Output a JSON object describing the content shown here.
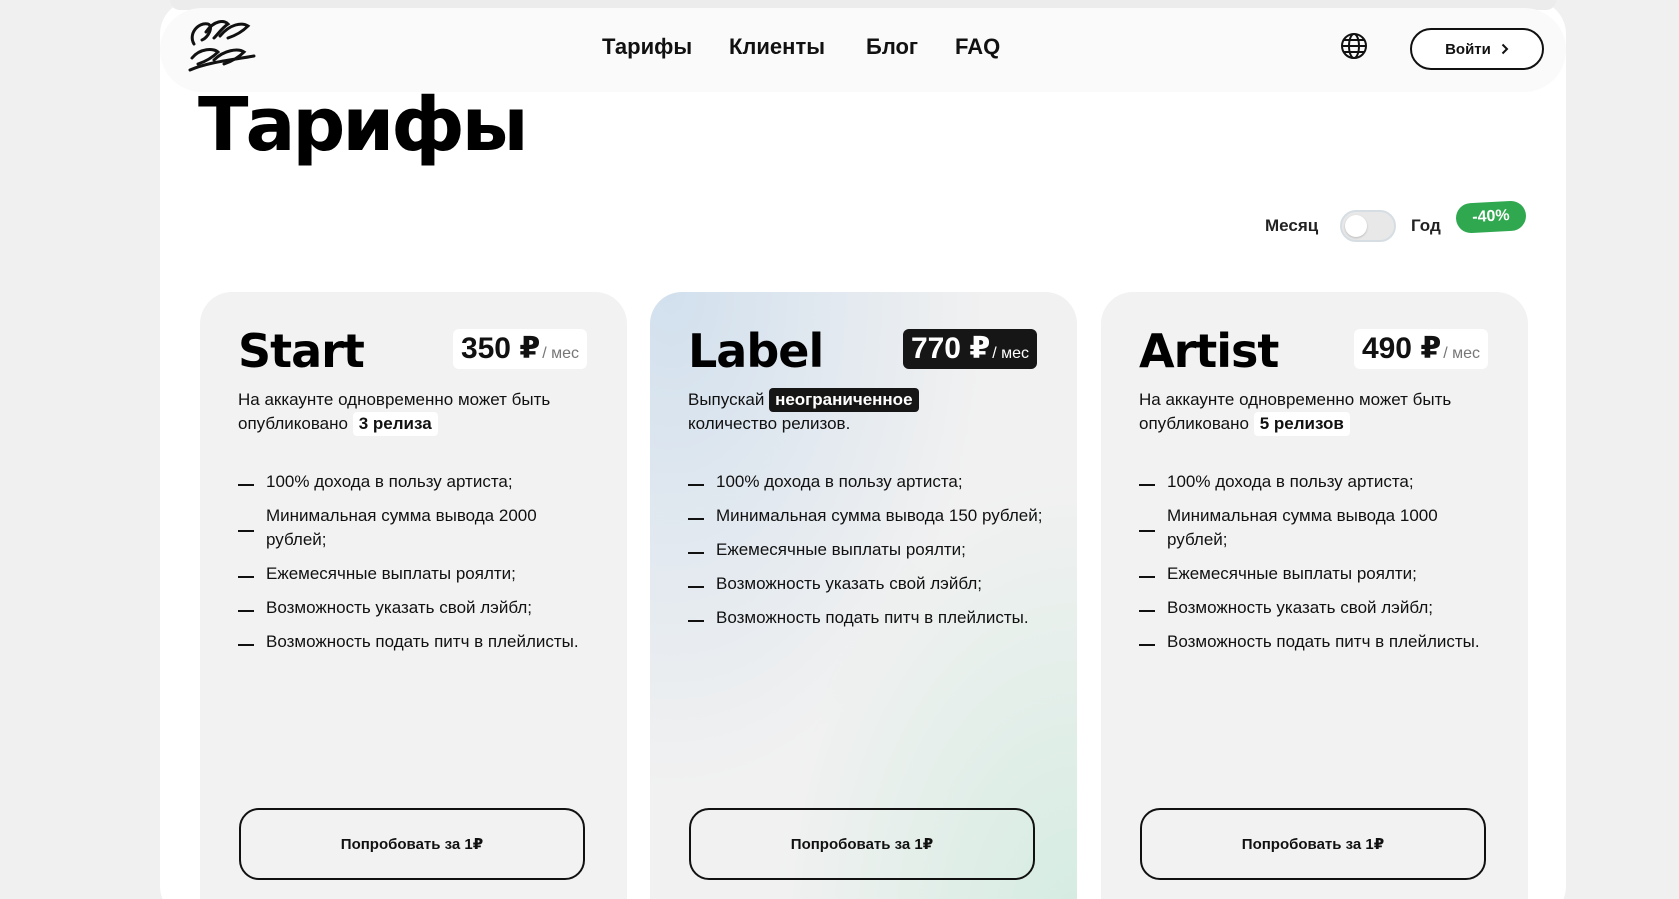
{
  "header": {
    "logo_alt": "Logo",
    "nav": [
      {
        "label": "Тарифы"
      },
      {
        "label": "Клиенты"
      },
      {
        "label": "Блог"
      },
      {
        "label": "FAQ"
      }
    ],
    "login_label": "Войти"
  },
  "page_title": "Тарифы",
  "billing": {
    "month_label": "Месяц",
    "year_label": "Год",
    "discount": "-40%",
    "selected": "Месяц"
  },
  "plans": [
    {
      "name": "Start",
      "price": "350 ₽",
      "period": "/ мес",
      "desc_before": "На аккаунте одновременно может быть опубликовано",
      "desc_highlight": "3 релиза",
      "desc_after": "",
      "features": [
        "100% дохода в пользу артиста;",
        "Минимальная сумма вывода 2000 рублей;",
        "Ежемесячные выплаты роялти;",
        "Возможность указать свой лэйбл;",
        "Возможность подать питч в плейлисты."
      ],
      "cta": "Попробовать за 1₽"
    },
    {
      "name": "Label",
      "price": "770 ₽",
      "period": "/ мес",
      "desc_before": "Выпускай",
      "desc_highlight": "неограниченное",
      "desc_after": "количество релизов.",
      "features": [
        "100% дохода в пользу артиста;",
        "Минимальная сумма вывода 150 рублей;",
        "Ежемесячные выплаты роялти;",
        "Возможность указать свой лэйбл;",
        "Возможность подать питч в плейлисты."
      ],
      "cta": "Попробовать за 1₽"
    },
    {
      "name": "Artist",
      "price": "490 ₽",
      "period": "/ мес",
      "desc_before": "На аккаунте одновременно может быть опубликовано",
      "desc_highlight": "5 релизов",
      "desc_after": "",
      "features": [
        "100% дохода в пользу артиста;",
        "Минимальная сумма вывода 1000 рублей;",
        "Ежемесячные выплаты роялти;",
        "Возможность указать свой лэйбл;",
        "Возможность подать питч в плейлисты."
      ],
      "cta": "Попробовать за 1₽"
    }
  ],
  "colors": {
    "accent_green": "#2fa84f",
    "dark": "#161616"
  }
}
